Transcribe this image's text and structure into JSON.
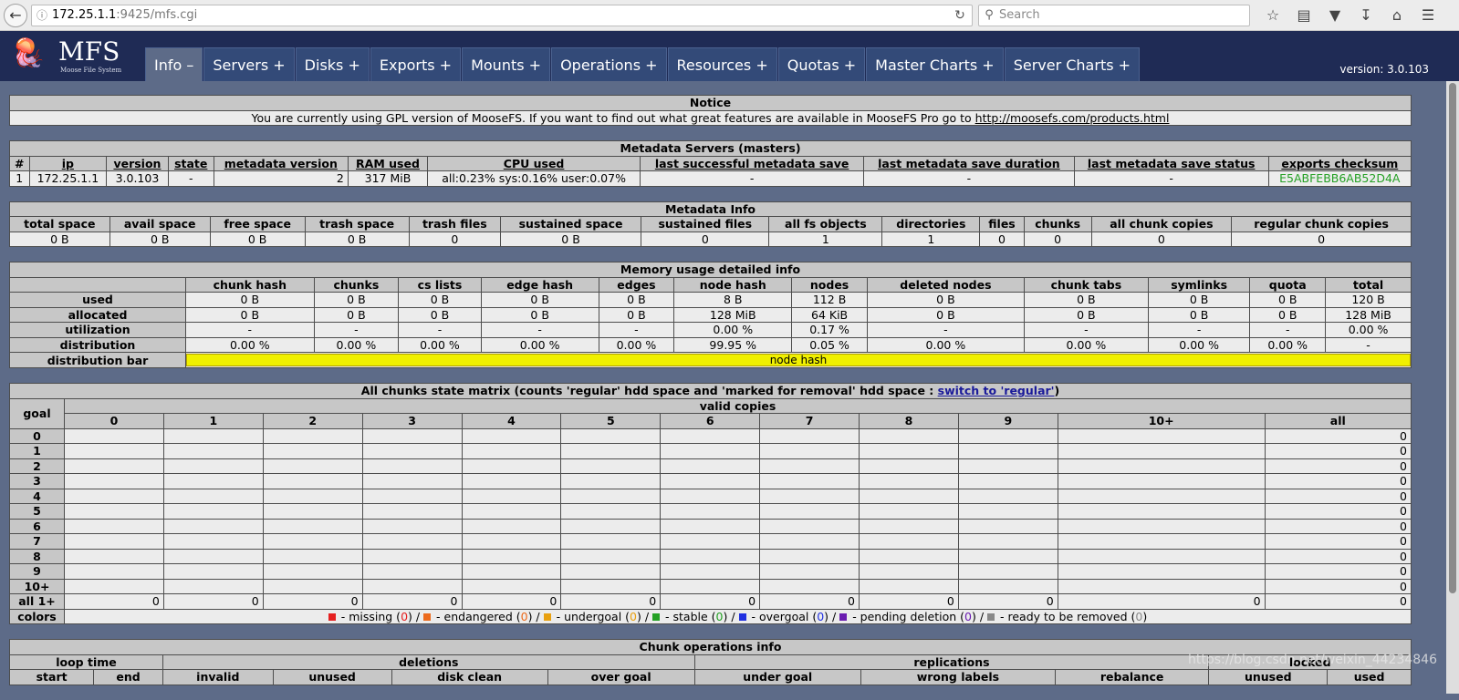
{
  "browser": {
    "url_host": "172.25.1.1",
    "url_rest": ":9425/mfs.cgi",
    "search_placeholder": "Search"
  },
  "header": {
    "logo_name": "MFS",
    "logo_sub": "Moose File System",
    "menu": [
      "Info –",
      "Servers +",
      "Disks +",
      "Exports +",
      "Mounts +",
      "Operations +",
      "Resources +",
      "Quotas +",
      "Master Charts +",
      "Server Charts +"
    ],
    "version": "version: 3.0.103"
  },
  "notice": {
    "title": "Notice",
    "text": "You are currently using GPL version of MooseFS. If you want to find out what great features are available in MooseFS Pro go to ",
    "link": "http://moosefs.com/products.html"
  },
  "masters": {
    "title": "Metadata Servers (masters)",
    "headers": [
      "#",
      "ip",
      "version",
      "state",
      "metadata version",
      "RAM used",
      "CPU used",
      "last successful metadata save",
      "last metadata save duration",
      "last metadata save status",
      "exports checksum"
    ],
    "row": [
      "1",
      "172.25.1.1",
      "3.0.103",
      "-",
      "2",
      "317 MiB",
      "all:0.23% sys:0.16% user:0.07%",
      "-",
      "-",
      "-",
      "E5ABFEBB6AB52D4A"
    ]
  },
  "metainfo": {
    "title": "Metadata Info",
    "headers": [
      "total space",
      "avail space",
      "free space",
      "trash space",
      "trash files",
      "sustained space",
      "sustained files",
      "all fs objects",
      "directories",
      "files",
      "chunks",
      "all chunk copies",
      "regular chunk copies"
    ],
    "row": [
      "0 B",
      "0 B",
      "0 B",
      "0 B",
      "0",
      "0 B",
      "0",
      "1",
      "1",
      "0",
      "0",
      "0",
      "0"
    ]
  },
  "memory": {
    "title": "Memory usage detailed info",
    "headers": [
      "chunk hash",
      "chunks",
      "cs lists",
      "edge hash",
      "edges",
      "node hash",
      "nodes",
      "deleted nodes",
      "chunk tabs",
      "symlinks",
      "quota",
      "total"
    ],
    "rows": [
      {
        "label": "used",
        "cells": [
          "0 B",
          "0 B",
          "0 B",
          "0 B",
          "0 B",
          "8 B",
          "112 B",
          "0 B",
          "0 B",
          "0 B",
          "0 B",
          "120 B"
        ]
      },
      {
        "label": "allocated",
        "cells": [
          "0 B",
          "0 B",
          "0 B",
          "0 B",
          "0 B",
          "128 MiB",
          "64 KiB",
          "0 B",
          "0 B",
          "0 B",
          "0 B",
          "128 MiB"
        ]
      },
      {
        "label": "utilization",
        "cells": [
          "-",
          "-",
          "-",
          "-",
          "-",
          "0.00 %",
          "0.17 %",
          "-",
          "-",
          "-",
          "-",
          "0.00 %"
        ]
      },
      {
        "label": "distribution",
        "cells": [
          "0.00 %",
          "0.00 %",
          "0.00 %",
          "0.00 %",
          "0.00 %",
          "99.95 %",
          "0.05 %",
          "0.00 %",
          "0.00 %",
          "0.00 %",
          "0.00 %",
          "-"
        ]
      }
    ],
    "bar_label": "distribution bar",
    "bar_text": "node hash"
  },
  "matrix": {
    "title": "All chunks state matrix (counts 'regular' hdd space and 'marked for removal' hdd space : ",
    "switch_link": "switch to 'regular'",
    "title_end": ")",
    "goal_label": "goal",
    "valid_label": "valid copies",
    "cols": [
      "0",
      "1",
      "2",
      "3",
      "4",
      "5",
      "6",
      "7",
      "8",
      "9",
      "10+",
      "all"
    ],
    "goals": [
      "0",
      "1",
      "2",
      "3",
      "4",
      "5",
      "6",
      "7",
      "8",
      "9",
      "10+"
    ],
    "all_label": "all 1+",
    "all_row": [
      "0",
      "0",
      "0",
      "0",
      "0",
      "0",
      "0",
      "0",
      "0",
      "0",
      "0",
      "0"
    ],
    "colors_label": "colors",
    "legend": [
      {
        "text": " - missing (",
        "count": "0",
        "color": "#e52020",
        "cls": "c-missing"
      },
      {
        "text": " - endangered (",
        "count": "0",
        "color": "#ec6a1c",
        "cls": "c-endangered"
      },
      {
        "text": " - undergoal (",
        "count": "0",
        "color": "#e8a010",
        "cls": "c-undergoal"
      },
      {
        "text": " - stable (",
        "count": "0",
        "color": "#24a024",
        "cls": "c-stable"
      },
      {
        "text": " - overgoal (",
        "count": "0",
        "color": "#2030e0",
        "cls": "c-overgoal"
      },
      {
        "text": " - pending deletion (",
        "count": "0",
        "color": "#6a1cb0",
        "cls": "c-pending"
      },
      {
        "text": " - ready to be removed (",
        "count": "0",
        "color": "#888888",
        "cls": "c-ready"
      }
    ]
  },
  "chunkops": {
    "title": "Chunk operations info",
    "group_headers": [
      "loop time",
      "deletions",
      "replications",
      "locked"
    ],
    "sub_headers": [
      "start",
      "end",
      "invalid",
      "unused",
      "disk clean",
      "over goal",
      "under goal",
      "wrong labels",
      "rebalance",
      "unused",
      "used"
    ]
  },
  "watermark": "https://blog.csdn.net/weixin_44234846"
}
